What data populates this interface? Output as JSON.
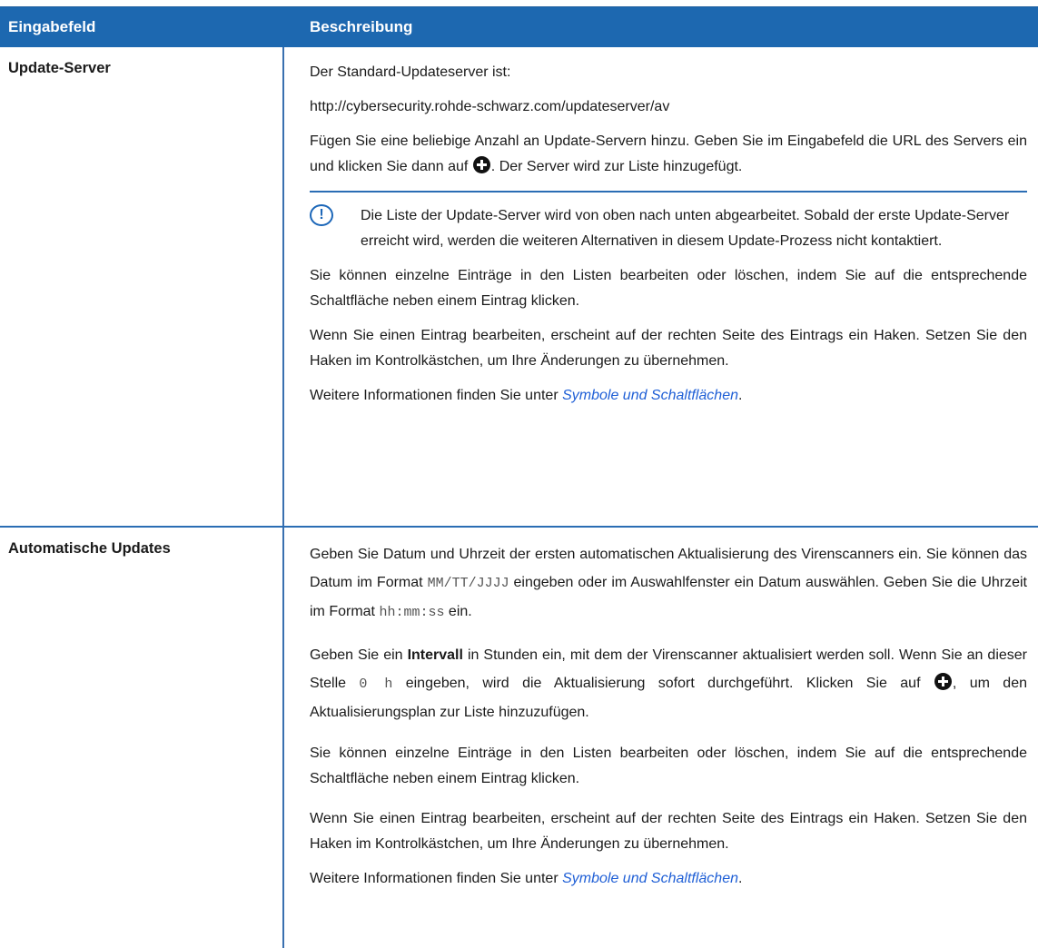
{
  "table": {
    "header": {
      "col1": "Eingabefeld",
      "col2": "Beschreibung"
    },
    "row1": {
      "field": "Update-Server",
      "p1": "Der Standard-Updateserver ist:",
      "p2": "http://cybersecurity.rohde-schwarz.com/updateserver/av",
      "p3a": "Fügen Sie eine beliebige Anzahl an Update-Servern hinzu. Geben Sie im Eingabefeld die URL des Servers ein und klicken Sie dann auf ",
      "p3b": ". Der Server wird zur Liste hinzugefügt.",
      "note": "Die Liste der Update-Server wird von oben nach unten abgearbeitet. Sobald der erste Update-Server erreicht wird, werden die weiteren Alternativen in diesem Update-Prozess nicht kontaktiert.",
      "p4": "Sie können einzelne Einträge in den Listen bearbeiten oder löschen, indem Sie auf die entsprechende Schaltfläche neben einem Eintrag klicken.",
      "p5": "Wenn Sie einen Eintrag bearbeiten, erscheint auf der rechten Seite des Eintrags ein Haken. Setzen Sie den Haken im Kontrolkästchen, um Ihre Änderungen zu übernehmen.",
      "p6a": "Weitere Informationen finden Sie unter ",
      "p6link": "Symbole und Schaltflächen",
      "p6b": "."
    },
    "row2": {
      "field": "Automatische Updates",
      "p1a": "Geben Sie Datum und Uhrzeit der ersten automatischen Aktualisierung des Virenscanners ein. Sie können das Datum im Format ",
      "p1code1": "MM/TT/JJJJ",
      "p1b": " eingeben oder im Auswahlfenster ein Datum auswählen. Geben Sie die Uhrzeit im Format ",
      "p1code2": "hh:mm:ss",
      "p1c": " ein.",
      "p2a": "Geben Sie ein ",
      "p2bold": "Intervall",
      "p2b": " in Stunden ein, mit dem der Virenscanner aktualisiert werden soll. Wenn Sie an dieser Stelle ",
      "p2code": "0 h",
      "p2c": " eingeben, wird die Aktualisierung sofort durchgeführt. Klicken Sie auf ",
      "p2d": ", um den Aktualisierungsplan zur Liste hinzuzufügen.",
      "p3": "Sie können einzelne Einträge in den Listen bearbeiten oder löschen, indem Sie auf die entsprechende Schaltfläche neben einem Eintrag klicken.",
      "p4": "Wenn Sie einen Eintrag bearbeiten, erscheint auf der rechten Seite des Eintrags ein Haken. Setzen Sie den Haken im Kontrolkästchen, um Ihre Änderungen zu übernehmen.",
      "p5a": "Weitere Informationen finden Sie unter ",
      "p5link": "Symbole und Schaltflächen",
      "p5b": "."
    },
    "icons": {
      "add": "plus-circle-icon",
      "note": "exclamation-circle-icon"
    },
    "colors": {
      "header_bg": "#1d68b0",
      "border": "#2a6db4",
      "link": "#1f5fd6"
    }
  }
}
